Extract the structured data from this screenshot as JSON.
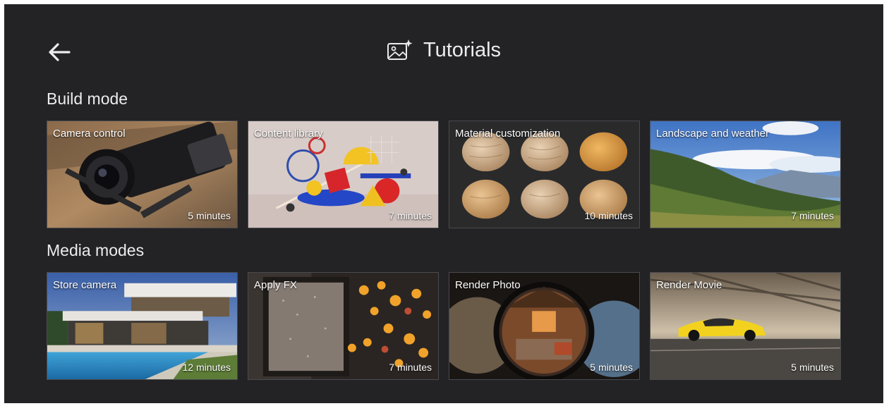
{
  "header": {
    "title": "Tutorials",
    "back_icon": "arrow-left-icon",
    "title_icon": "image-sparkle-icon"
  },
  "sections": [
    {
      "title": "Build mode",
      "cards": [
        {
          "label": "Camera control",
          "duration": "5 minutes",
          "thumbnail": "camera-rig"
        },
        {
          "label": "Content library",
          "duration": "7 minutes",
          "thumbnail": "geometric-shapes"
        },
        {
          "label": "Material customization",
          "duration": "10 minutes",
          "thumbnail": "wood-spheres"
        },
        {
          "label": "Landscape and weather",
          "duration": "7 minutes",
          "thumbnail": "mountain-landscape"
        }
      ]
    },
    {
      "title": "Media modes",
      "cards": [
        {
          "label": "Store camera",
          "duration": "12 minutes",
          "thumbnail": "modern-house-pool"
        },
        {
          "label": "Apply FX",
          "duration": "7 minutes",
          "thumbnail": "rainy-window-bokeh"
        },
        {
          "label": "Render Photo",
          "duration": "5 minutes",
          "thumbnail": "fisheye-interior"
        },
        {
          "label": "Render Movie",
          "duration": "5 minutes",
          "thumbnail": "yellow-sports-car"
        }
      ]
    }
  ],
  "colors": {
    "background": "#232326",
    "text": "#ececec"
  }
}
